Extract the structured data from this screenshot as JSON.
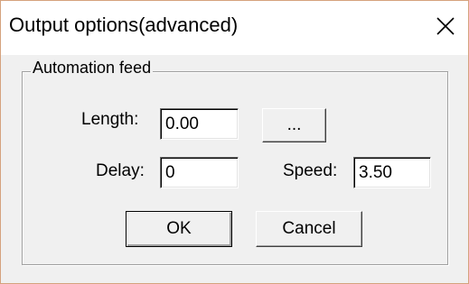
{
  "window": {
    "title": "Output options(advanced)",
    "close_icon": "close-icon"
  },
  "group": {
    "label": "Automation feed"
  },
  "fields": {
    "length_label": "Length:",
    "length_value": "0.00",
    "delay_label": "Delay:",
    "delay_value": "0",
    "speed_label": "Speed:",
    "speed_value": "3.50"
  },
  "buttons": {
    "browse_label": "...",
    "ok_label": "OK",
    "cancel_label": "Cancel"
  },
  "colors": {
    "window_border": "#d5a27d",
    "dialog_background": "#f0f0f0",
    "titlebar_background": "#ffffff"
  }
}
